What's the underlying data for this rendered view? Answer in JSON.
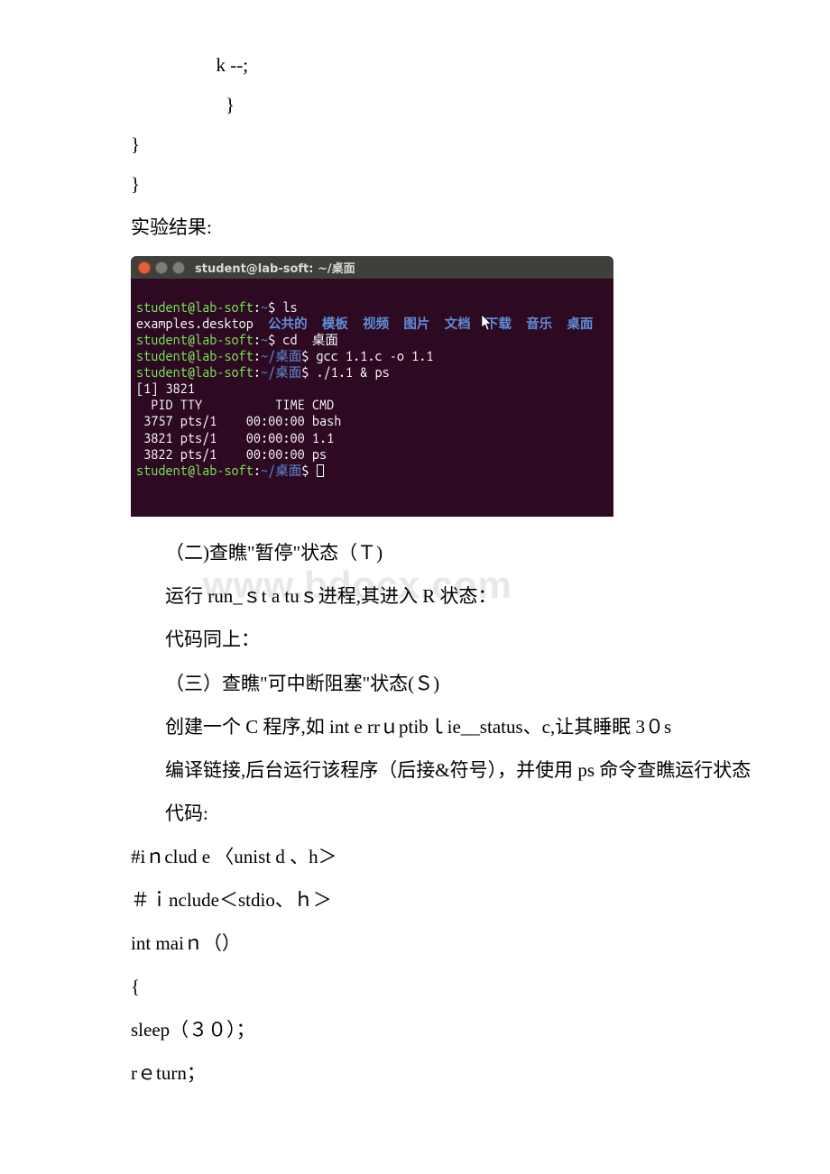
{
  "code_top": {
    "l1": "                  k --;",
    "l2": "                    }",
    "l3": "}",
    "l4": "}"
  },
  "result_label": "实验结果:",
  "terminal": {
    "title": "student@lab-soft: ~/桌面",
    "prompt_user": "student@lab-soft",
    "tilde": "~",
    "dollar": "$",
    "cmd_ls": "ls",
    "ls_out_file": "examples.desktop",
    "ls_out_dirs": "  公共的  模板  视频  图片  文档  下载  音乐  桌面",
    "cmd_cd": "cd  桌面",
    "path_desktop": "~/桌面",
    "cmd_gcc": "gcc 1.1.c -o 1.1",
    "cmd_run": "./1.1 & ps",
    "job": "[1] 3821",
    "ps_header": "  PID TTY          TIME CMD",
    "ps_row1": " 3757 pts/1    00:00:00 bash",
    "ps_row2": " 3821 pts/1    00:00:00 1.1",
    "ps_row3": " 3822 pts/1    00:00:00 ps"
  },
  "body": {
    "p1": "（二)查瞧\"暂停\"状态（Ｔ)",
    "p2_prefix": "运行 run_ｓt a tuｓ进程,其进入 R 状态：",
    "p3": "代码同上：",
    "p4": "（三）查瞧\"可中断阻塞\"状态(Ｓ)",
    "p5": "创建一个 C 程序,如 int e rrｕptibｌie__status、c,让其睡眠 3０s",
    "p6": "编译链接,后台运行该程序（后接&符号），并使用 ps 命令查瞧运行状态",
    "p7": "代码:"
  },
  "code2": {
    "l1": "#iｎclud e 〈unist d 、h＞",
    "l2": "＃ｉnclude＜stdio、ｈ＞",
    "l3": "int maiｎ（）",
    "l4": "{",
    "l5": " sleep（３０）；",
    "l6": " rｅturn；"
  },
  "watermark_text": "www.bdocx.com"
}
